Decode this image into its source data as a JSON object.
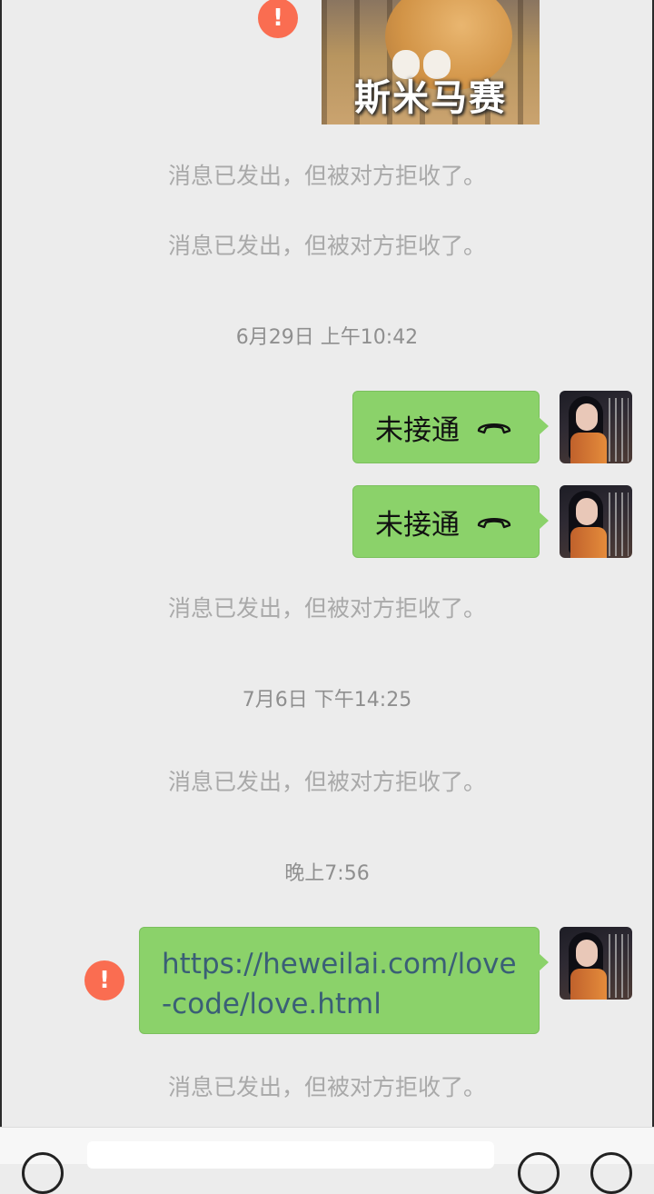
{
  "sticker": {
    "caption": "斯米马赛"
  },
  "error_icon_glyph": "!",
  "system_notices": {
    "n1": "消息已发出，但被对方拒收了。",
    "n2": "消息已发出，但被对方拒收了。",
    "n3": "消息已发出，但被对方拒收了。",
    "n4": "消息已发出，但被对方拒收了。",
    "n5": "消息已发出，但被对方拒收了。"
  },
  "timestamps": {
    "t1": "6月29日 上午10:42",
    "t2": "7月6日 下午14:25",
    "t3": "晚上7:56"
  },
  "messages": {
    "call1": "未接通",
    "call2": "未接通",
    "link": "https://heweilai.com/love-code/love.html"
  },
  "colors": {
    "bubble_green": "#8bd26a",
    "error_red": "#fa6d51",
    "link_text": "#3a5f76",
    "chat_background": "#ececec"
  },
  "icons": {
    "call": "phone-hangup-icon",
    "error": "error-alert-icon"
  }
}
